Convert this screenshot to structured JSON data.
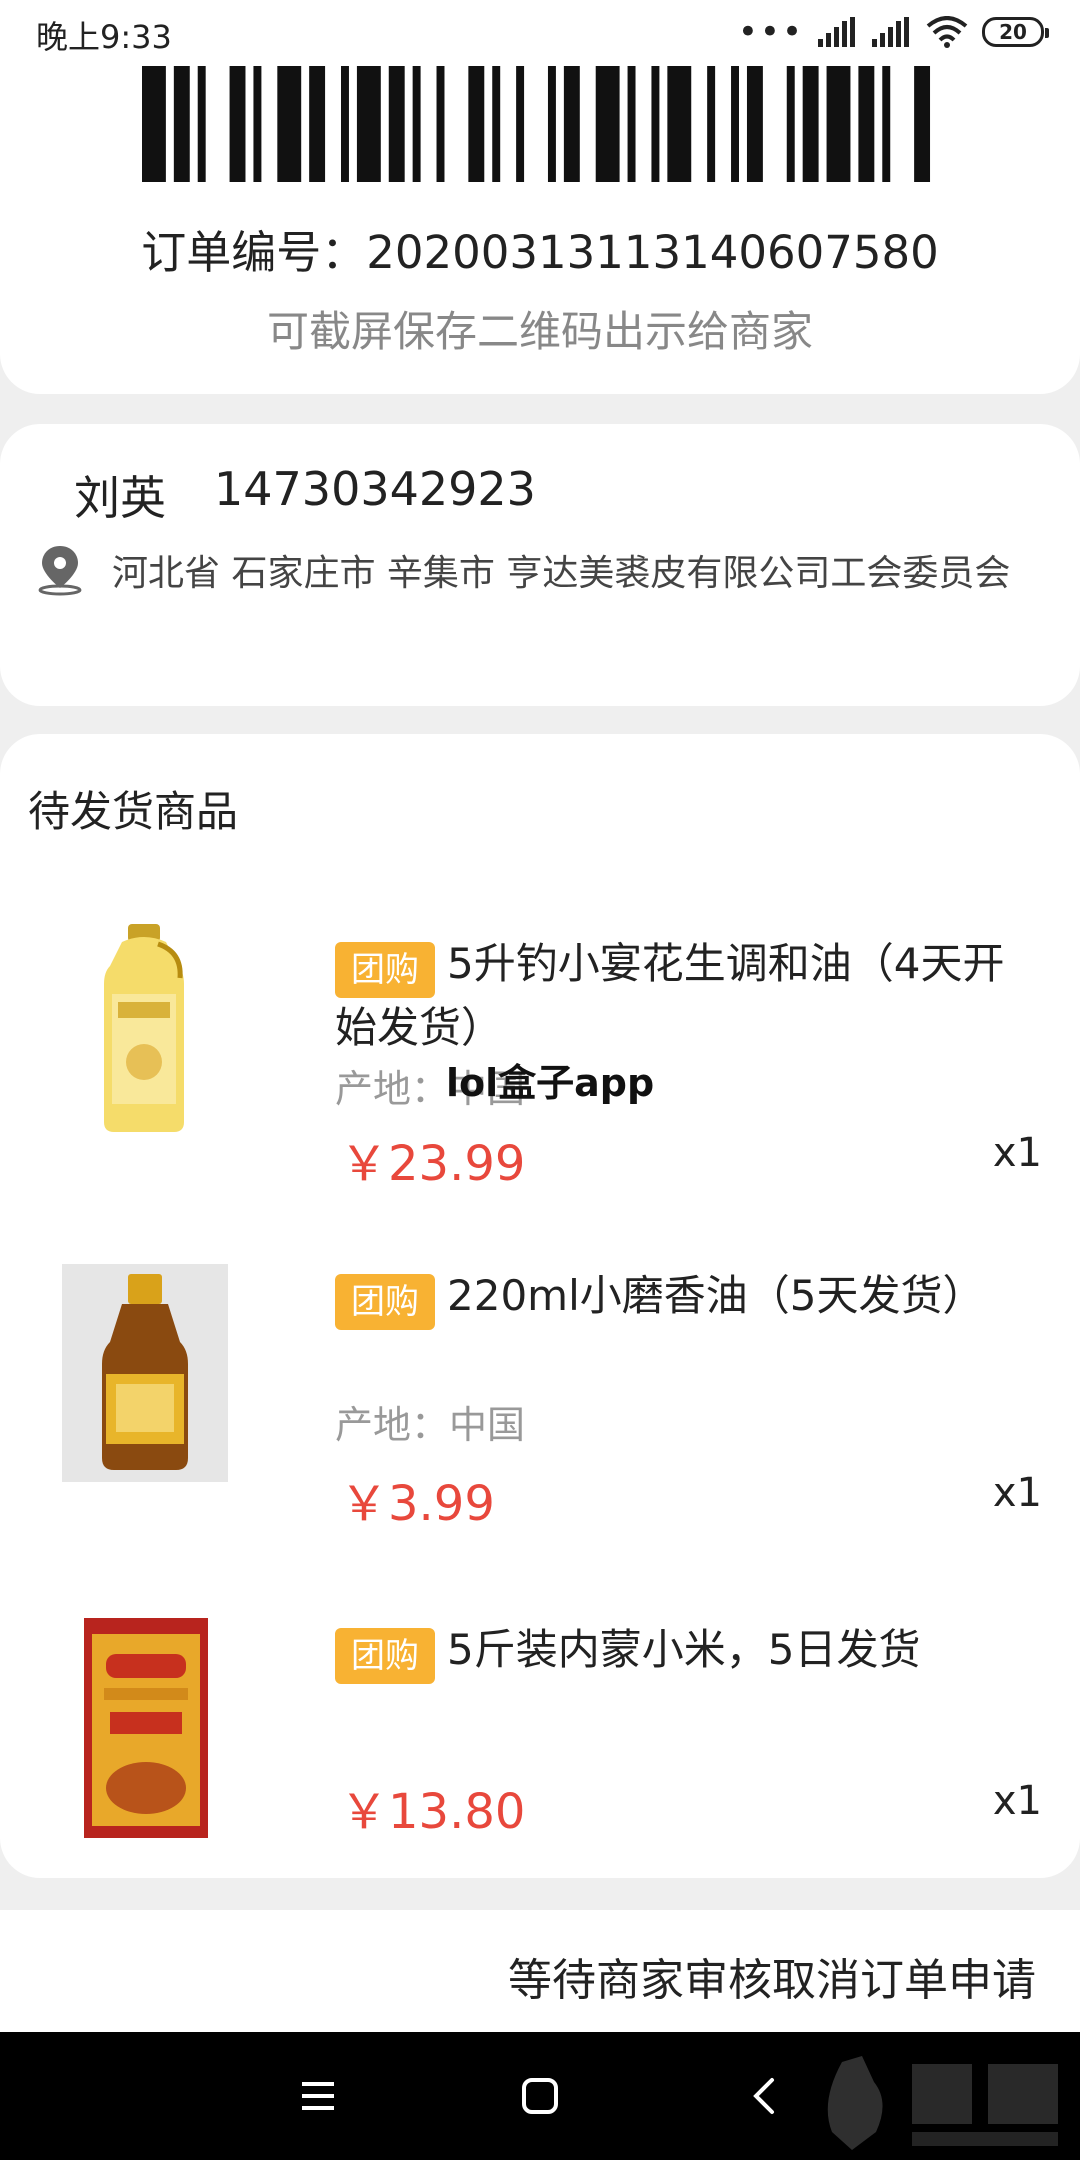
{
  "status_bar": {
    "time": "晚上9:33",
    "battery": "20",
    "icons": [
      "dots-icon",
      "signal-icon",
      "signal-icon",
      "wifi-icon",
      "battery-icon"
    ]
  },
  "order": {
    "number_label": "订单编号：20200313113140607580",
    "save_tip": "可截屏保存二维码出示给商家"
  },
  "address": {
    "name": "刘英",
    "phone": "14730342923",
    "location": "河北省 石家庄市 辛集市 亨达美裘皮有限公司工会委员会"
  },
  "goods": {
    "title": "待发货商品",
    "items": [
      {
        "tag": "团购",
        "name": "5升钓小宴花生调和油（4天开始发货）",
        "origin": "产地：中国",
        "price": "￥23.99",
        "qty": "x1"
      },
      {
        "tag": "团购",
        "name": "220ml小磨香油（5天发货）",
        "origin": "产地：中国",
        "price": "￥3.99",
        "qty": "x1"
      },
      {
        "tag": "团购",
        "name": "5斤装内蒙小米，5日发货",
        "origin": "",
        "price": "￥13.80",
        "qty": "x1"
      }
    ]
  },
  "overlay_text": "lol盒子app",
  "bottom": {
    "status_text": "等待商家审核取消订单申请"
  },
  "colors": {
    "price": "#e8483c",
    "tag": "#f8b233",
    "page_bg": "#efefef"
  }
}
